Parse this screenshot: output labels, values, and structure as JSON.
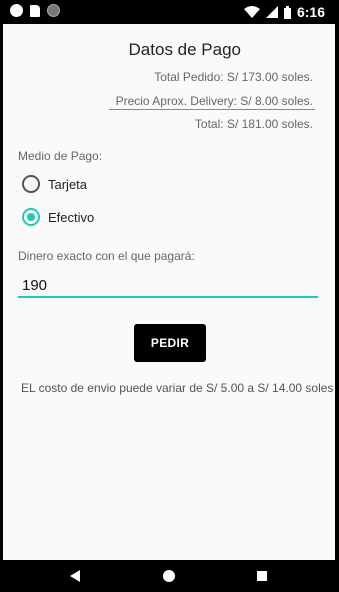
{
  "status_bar": {
    "time": "6:16"
  },
  "screen": {
    "title": "Datos de Pago",
    "total_pedido": "Total Pedido: S/ 173.00 soles.",
    "precio_delivery": "Precio Aprox. Delivery: S/ 8.00 soles.",
    "total": "Total: S/ 181.00 soles.",
    "payment_label": "Medio de Pago:",
    "options": [
      {
        "label": "Tarjeta",
        "selected": false
      },
      {
        "label": "Efectivo",
        "selected": true
      }
    ],
    "cash_label": "Dinero exacto con el que pagará:",
    "cash_value": "190",
    "submit_label": "PEDIR",
    "note": "EL costo de envio puede variar de S/ 5.00 a S/ 14.00 soles"
  },
  "colors": {
    "accent": "#20c9b5",
    "button": "#000000"
  }
}
